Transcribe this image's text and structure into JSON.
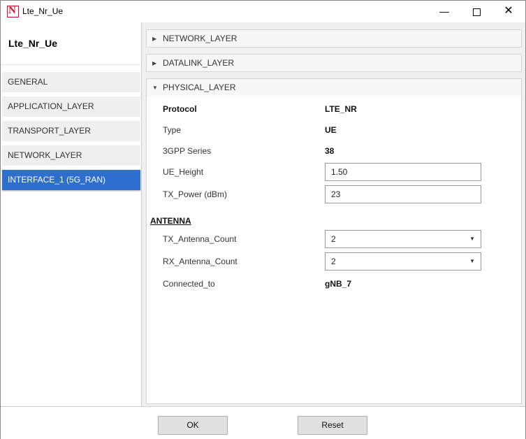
{
  "window": {
    "title": "Lte_Nr_Ue",
    "icon_letter": "N",
    "minimize": "—",
    "close": "✕"
  },
  "sidebar": {
    "device_title": "Lte_Nr_Ue",
    "items": [
      {
        "label": "GENERAL"
      },
      {
        "label": "APPLICATION_LAYER"
      },
      {
        "label": "TRANSPORT_LAYER"
      },
      {
        "label": "NETWORK_LAYER"
      },
      {
        "label": "INTERFACE_1 (5G_RAN)",
        "active": true
      }
    ]
  },
  "sections": [
    {
      "label": "NETWORK_LAYER",
      "expanded": false,
      "icon": "▶"
    },
    {
      "label": "DATALINK_LAYER",
      "expanded": false,
      "icon": "▶"
    },
    {
      "label": "PHYSICAL_LAYER",
      "expanded": true,
      "icon": "▼"
    }
  ],
  "physical": {
    "protocol": {
      "label": "Protocol",
      "value": "LTE_NR"
    },
    "type": {
      "label": "Type",
      "value": "UE"
    },
    "series": {
      "label": "3GPP Series",
      "value": "38"
    },
    "ue_height": {
      "label": "UE_Height",
      "value": "1.50"
    },
    "tx_power": {
      "label": "TX_Power (dBm)",
      "value": "23"
    },
    "antenna_heading": "ANTENNA",
    "tx_antenna": {
      "label": "TX_Antenna_Count",
      "value": "2",
      "caret": "▼"
    },
    "rx_antenna": {
      "label": "RX_Antenna_Count",
      "value": "2",
      "caret": "▼"
    },
    "connected_to": {
      "label": "Connected_to",
      "value": "gNB_7"
    }
  },
  "footer": {
    "ok_label": "OK",
    "reset_label": "Reset"
  },
  "colors": {
    "accent": "#2d6fce",
    "brand_red": "#c8102e"
  }
}
